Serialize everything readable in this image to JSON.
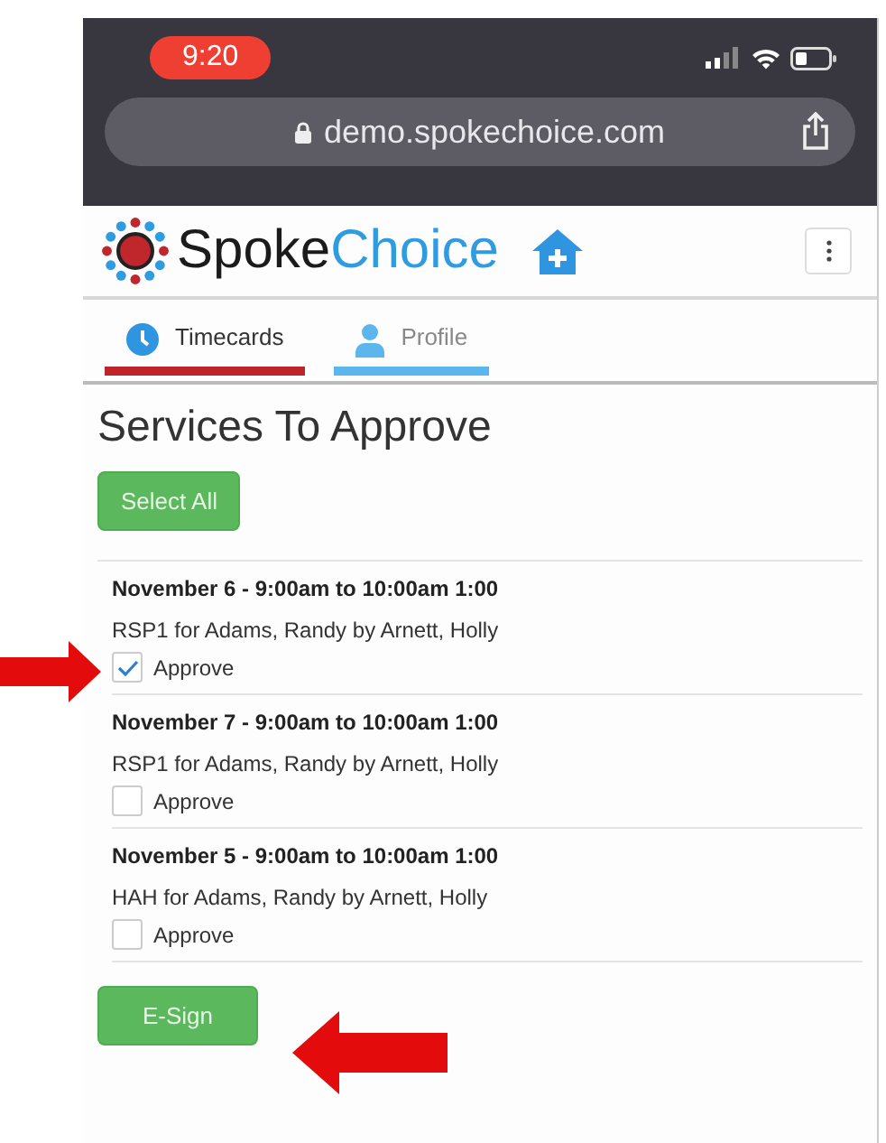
{
  "status_bar": {
    "time": "9:20"
  },
  "browser": {
    "url": "demo.spokechoice.com"
  },
  "header": {
    "logo_first": "Spoke",
    "logo_second": "Choice"
  },
  "tabs": [
    {
      "label": "Timecards",
      "selected": true
    },
    {
      "label": "Profile",
      "selected": false
    }
  ],
  "page_title": "Services To Approve",
  "select_all_button": "Select All",
  "services": [
    {
      "title": "November 6 - 9:00am to 10:00am 1:00",
      "detail": "RSP1 for Adams, Randy by Arnett, Holly",
      "approve_label": "Approve",
      "checked": true
    },
    {
      "title": "November 7 - 9:00am to 10:00am 1:00",
      "detail": "RSP1 for Adams, Randy by Arnett, Holly",
      "approve_label": "Approve",
      "checked": false
    },
    {
      "title": "November 5 - 9:00am to 10:00am 1:00",
      "detail": "HAH for Adams, Randy by Arnett, Holly",
      "approve_label": "Approve",
      "checked": false
    }
  ],
  "esign_button": "E-Sign"
}
